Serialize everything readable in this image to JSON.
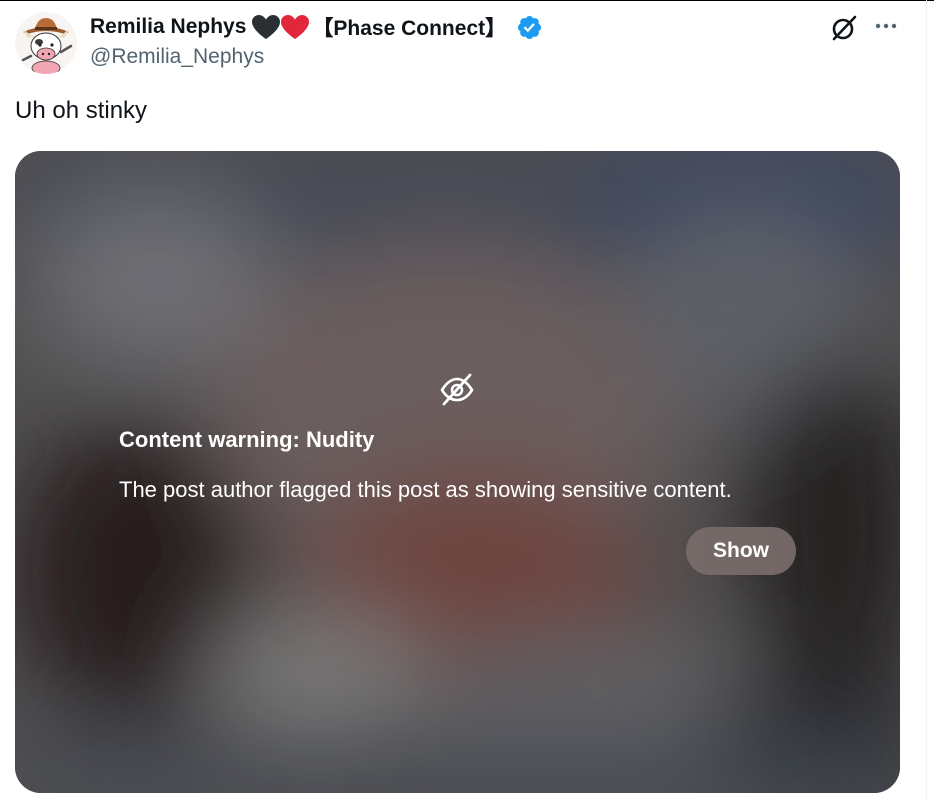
{
  "post": {
    "author": {
      "display_name": "Remilia Nephys",
      "emoji": [
        "black-heart",
        "red-heart"
      ],
      "tag": "【Phase Connect】",
      "handle": "@Remilia_Nephys",
      "verified": true,
      "avatar": "cow-with-cowboy-hat-avatar"
    },
    "text": "Uh oh stinky",
    "actions": {
      "grok_icon": "grok-icon",
      "more_icon": "more-options-icon"
    },
    "media": {
      "hidden_icon": "eye-slash-icon",
      "warning_title": "Content warning: Nudity",
      "warning_text": "The post author flagged this post as showing sensitive content.",
      "show_label": "Show"
    }
  },
  "colors": {
    "verified_blue": "#1d9bf0",
    "text_primary": "#0f1419",
    "text_secondary": "#536471",
    "heart_red": "#e2263b",
    "heart_black": "#292f33"
  }
}
